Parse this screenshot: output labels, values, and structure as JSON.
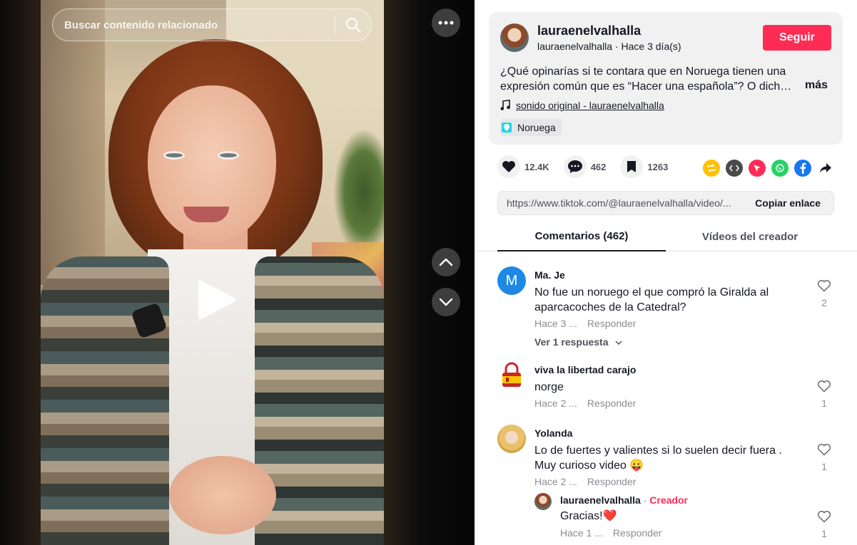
{
  "search": {
    "placeholder": "Buscar contenido relacionado"
  },
  "author": {
    "name": "lauraenelvalhalla",
    "handle_time": "lauraenelvalhalla · Hace 3 día(s)",
    "follow_label": "Seguir"
  },
  "description": {
    "text": "¿Qué opinarías si te contara que en Noruega tienen una expresión común que es “Hacer una española”? O dich…",
    "more_label": "más",
    "music": "sonido original - lauraenelvalhalla",
    "location": "Noruega"
  },
  "stats": {
    "likes": "12.4K",
    "comments": "462",
    "saves": "1263"
  },
  "share": {
    "url": "https://www.tiktok.com/@lauraenelvalhalla/video/...",
    "copy_label": "Copiar enlace"
  },
  "tabs": {
    "comments": "Comentarios (462)",
    "videos": "Vídeos del creador"
  },
  "comments": [
    {
      "name": "Ma. Je",
      "avatar_letter": "M",
      "text": "No fue un noruego el que compró la Giralda al aparcacoches de la Catedral?",
      "time": "Hace 3 ...",
      "reply": "Responder",
      "likes": "2",
      "view_replies": "Ver 1 respuesta"
    },
    {
      "name": "viva la libertad carajo",
      "text": "norge",
      "time": "Hace 2 ...",
      "reply": "Responder",
      "likes": "1"
    },
    {
      "name": "Yolanda",
      "text": "Lo de fuertes y valientes si lo suelen decir fuera . Muy curioso video 😛",
      "time": "Hace 2 ...",
      "reply": "Responder",
      "likes": "1"
    }
  ],
  "creator_reply": {
    "name": "lauraenelvalhalla",
    "separator": " · ",
    "tag": "Creador",
    "text": "Gracias!❤️",
    "time": "Hace 1 ...",
    "reply": "Responder",
    "likes": "1"
  },
  "colors": {
    "accent": "#fe2c55",
    "avatar_blue": "#1e88e5"
  }
}
